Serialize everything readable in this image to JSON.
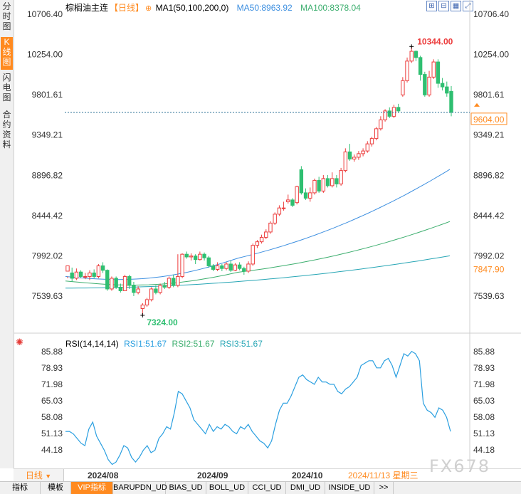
{
  "sidebar": {
    "tabs": [
      {
        "label": "分时图",
        "active": false
      },
      {
        "label": "K线图",
        "active": true
      },
      {
        "label": "闪电图",
        "active": false
      },
      {
        "label": "合约资料",
        "active": false
      }
    ]
  },
  "header": {
    "name": "棕榈油主连",
    "period": "【日线】",
    "ma_label": "MA1(50,100,200,0)",
    "ma50_label": "MA50:8963.92",
    "ma100_label": "MA100:8378.04",
    "toolbar_icons": [
      "zoom-in-icon",
      "zoom-out-icon",
      "grid-icon",
      "fullscreen-icon"
    ]
  },
  "indicator": {
    "label": "RSI(14,14,14)",
    "rsi1": "RSI1:51.67",
    "rsi2": "RSI2:51.67",
    "rsi3": "RSI3:51.67"
  },
  "colors": {
    "up": "#ec3b3b",
    "down": "#2fbf71",
    "ma50": "#3d8fe0",
    "ma100": "#3cae6e",
    "ma200": "#27a6b5",
    "rsi": "#2a9fe0",
    "accent": "#ff8a1f"
  },
  "price_axis": {
    "ticks": [
      "10706.40",
      "10254.00",
      "9801.61",
      "9349.21",
      "8896.82",
      "8444.42",
      "7992.02",
      "7539.63"
    ],
    "last_price": "9604.00",
    "ma_value_tag": "7847.90",
    "high_label": "10344.00",
    "low_label": "7324.00"
  },
  "rsi_axis": {
    "ticks": [
      "85.88",
      "78.93",
      "71.98",
      "65.03",
      "58.08",
      "51.13",
      "44.18"
    ]
  },
  "dates": {
    "labels": [
      "2024/08",
      "2024/09",
      "2024/10"
    ],
    "cursor": "2024/11/13 星期三",
    "period_tab": "日线"
  },
  "bottom_tabs": [
    "指标",
    "模板",
    "VIP指标",
    "BARUPDN_UD",
    "BIAS_UD",
    "BOLL_UD",
    "CCI_UD",
    "DMI_UD",
    "INSIDE_UD",
    ">>"
  ],
  "watermark": "FX678",
  "chart_data": {
    "type": "candlestick",
    "y_range": [
      7400,
      10800
    ],
    "candles": [
      [
        7820,
        7880,
        7760,
        7740
      ],
      [
        7800,
        7740,
        7860,
        7700
      ],
      [
        7740,
        7810,
        7850,
        7720
      ],
      [
        7810,
        7760,
        7830,
        7740
      ],
      [
        7760,
        7760,
        7800,
        7730
      ],
      [
        7760,
        7800,
        7830,
        7720
      ],
      [
        7800,
        7760,
        7840,
        7740
      ],
      [
        7760,
        7880,
        7900,
        7740
      ],
      [
        7880,
        7830,
        7920,
        7800
      ],
      [
        7830,
        7620,
        7840,
        7600
      ],
      [
        7620,
        7740,
        7760,
        7600
      ],
      [
        7740,
        7640,
        7760,
        7620
      ],
      [
        7640,
        7600,
        7680,
        7580
      ],
      [
        7600,
        7760,
        7780,
        7600
      ],
      [
        7760,
        7660,
        7780,
        7620
      ],
      [
        7660,
        7580,
        7700,
        7540
      ],
      [
        7580,
        7620,
        7650,
        7560
      ],
      [
        7400,
        7440,
        7460,
        7324
      ],
      [
        7440,
        7500,
        7520,
        7420
      ],
      [
        7500,
        7620,
        7640,
        7480
      ],
      [
        7620,
        7580,
        7660,
        7560
      ],
      [
        7580,
        7660,
        7680,
        7560
      ],
      [
        7660,
        7640,
        7700,
        7620
      ],
      [
        7640,
        7740,
        7760,
        7620
      ],
      [
        7740,
        7660,
        7780,
        7640
      ],
      [
        7660,
        7760,
        8010,
        7640
      ],
      [
        7760,
        8010,
        8020,
        7740
      ],
      [
        8010,
        7980,
        8040,
        7960
      ],
      [
        7980,
        7990,
        8020,
        7940
      ],
      [
        7990,
        7950,
        8010,
        7900
      ],
      [
        7950,
        8010,
        8040,
        7940
      ],
      [
        8010,
        7970,
        8030,
        7940
      ],
      [
        7970,
        7880,
        7990,
        7860
      ],
      [
        7880,
        7840,
        7900,
        7820
      ],
      [
        7840,
        7880,
        7920,
        7820
      ],
      [
        7880,
        7850,
        7900,
        7820
      ],
      [
        7850,
        7900,
        7920,
        7830
      ],
      [
        7900,
        7830,
        7940,
        7810
      ],
      [
        7830,
        7890,
        7910,
        7820
      ],
      [
        7890,
        7850,
        7920,
        7830
      ],
      [
        7850,
        7820,
        7870,
        7780
      ],
      [
        7820,
        7900,
        7930,
        7800
      ],
      [
        7900,
        8110,
        8130,
        7880
      ],
      [
        8110,
        8150,
        8170,
        8080
      ],
      [
        8150,
        8200,
        8230,
        8130
      ],
      [
        8200,
        8260,
        8290,
        8180
      ],
      [
        8260,
        8360,
        8380,
        8240
      ],
      [
        8360,
        8460,
        8480,
        8340
      ],
      [
        8460,
        8530,
        8560,
        8440
      ],
      [
        8530,
        8530,
        8600,
        8500
      ],
      [
        8600,
        8620,
        8680,
        8580
      ],
      [
        8620,
        8560,
        8640,
        8540
      ],
      [
        8590,
        8770,
        8780,
        8570
      ],
      [
        8960,
        8700,
        9000,
        8680
      ],
      [
        8700,
        8640,
        8750,
        8620
      ],
      [
        8640,
        8700,
        8760,
        8600
      ],
      [
        8700,
        8840,
        8860,
        8680
      ],
      [
        8840,
        8720,
        8880,
        8700
      ],
      [
        8720,
        8860,
        8900,
        8700
      ],
      [
        8860,
        8780,
        8900,
        8760
      ],
      [
        8780,
        8860,
        8930,
        8760
      ],
      [
        8860,
        8800,
        8900,
        8760
      ],
      [
        8800,
        8950,
        8980,
        8780
      ],
      [
        8950,
        9160,
        9200,
        8930
      ],
      [
        9160,
        9080,
        9250,
        9060
      ],
      [
        9080,
        9100,
        9130,
        9050
      ],
      [
        9100,
        9140,
        9170,
        9070
      ],
      [
        9140,
        9170,
        9200,
        9110
      ],
      [
        9170,
        9250,
        9280,
        9150
      ],
      [
        9250,
        9310,
        9330,
        9220
      ],
      [
        9310,
        9420,
        9440,
        9290
      ],
      [
        9420,
        9520,
        9560,
        9400
      ],
      [
        9520,
        9620,
        9640,
        9500
      ],
      [
        9620,
        9560,
        9660,
        9540
      ],
      [
        9560,
        9660,
        9690,
        9540
      ],
      [
        9660,
        9620,
        9700,
        9600
      ],
      [
        9800,
        9960,
        10000,
        9780
      ],
      [
        9960,
        10180,
        10220,
        9940
      ],
      [
        10180,
        10290,
        10344,
        10160
      ],
      [
        10290,
        10220,
        10300,
        10180
      ],
      [
        10220,
        10030,
        10240,
        9960
      ],
      [
        10030,
        9800,
        10060,
        9780
      ],
      [
        9800,
        10000,
        10070,
        9780
      ],
      [
        10000,
        10170,
        10200,
        9980
      ],
      [
        10170,
        9930,
        10200,
        9880
      ],
      [
        9930,
        9890,
        9990,
        9850
      ],
      [
        9890,
        9820,
        9950,
        9780
      ],
      [
        9840,
        9604,
        9900,
        9560
      ]
    ],
    "ma_lines": [
      {
        "name": "MA50",
        "start": 7760,
        "end": 8963.92
      },
      {
        "name": "MA100",
        "start": 7710,
        "end": 8378.04
      },
      {
        "name": "MA200",
        "start": 7630,
        "end": 7992.02
      }
    ],
    "rsi": [
      52,
      52,
      51,
      49,
      47,
      46,
      53,
      56,
      50,
      47,
      44,
      40,
      38,
      39,
      42,
      46,
      45,
      41,
      39,
      41,
      44,
      46,
      43,
      44,
      49,
      51,
      54,
      53,
      60,
      69,
      68,
      65,
      62,
      57,
      55,
      53,
      51,
      55,
      52,
      54,
      53,
      55,
      54,
      52,
      51,
      54,
      53,
      55,
      52,
      50,
      48,
      47,
      45,
      48,
      55,
      61,
      64,
      64,
      67,
      71,
      75,
      76,
      74,
      73,
      72,
      75,
      73,
      73,
      72,
      72,
      69,
      68,
      70,
      71,
      73,
      75,
      80,
      81,
      82,
      82,
      79,
      79,
      82,
      83,
      80,
      75,
      80,
      85,
      84,
      86,
      85,
      82,
      64,
      61,
      60,
      58,
      62,
      61,
      58,
      52
    ]
  }
}
